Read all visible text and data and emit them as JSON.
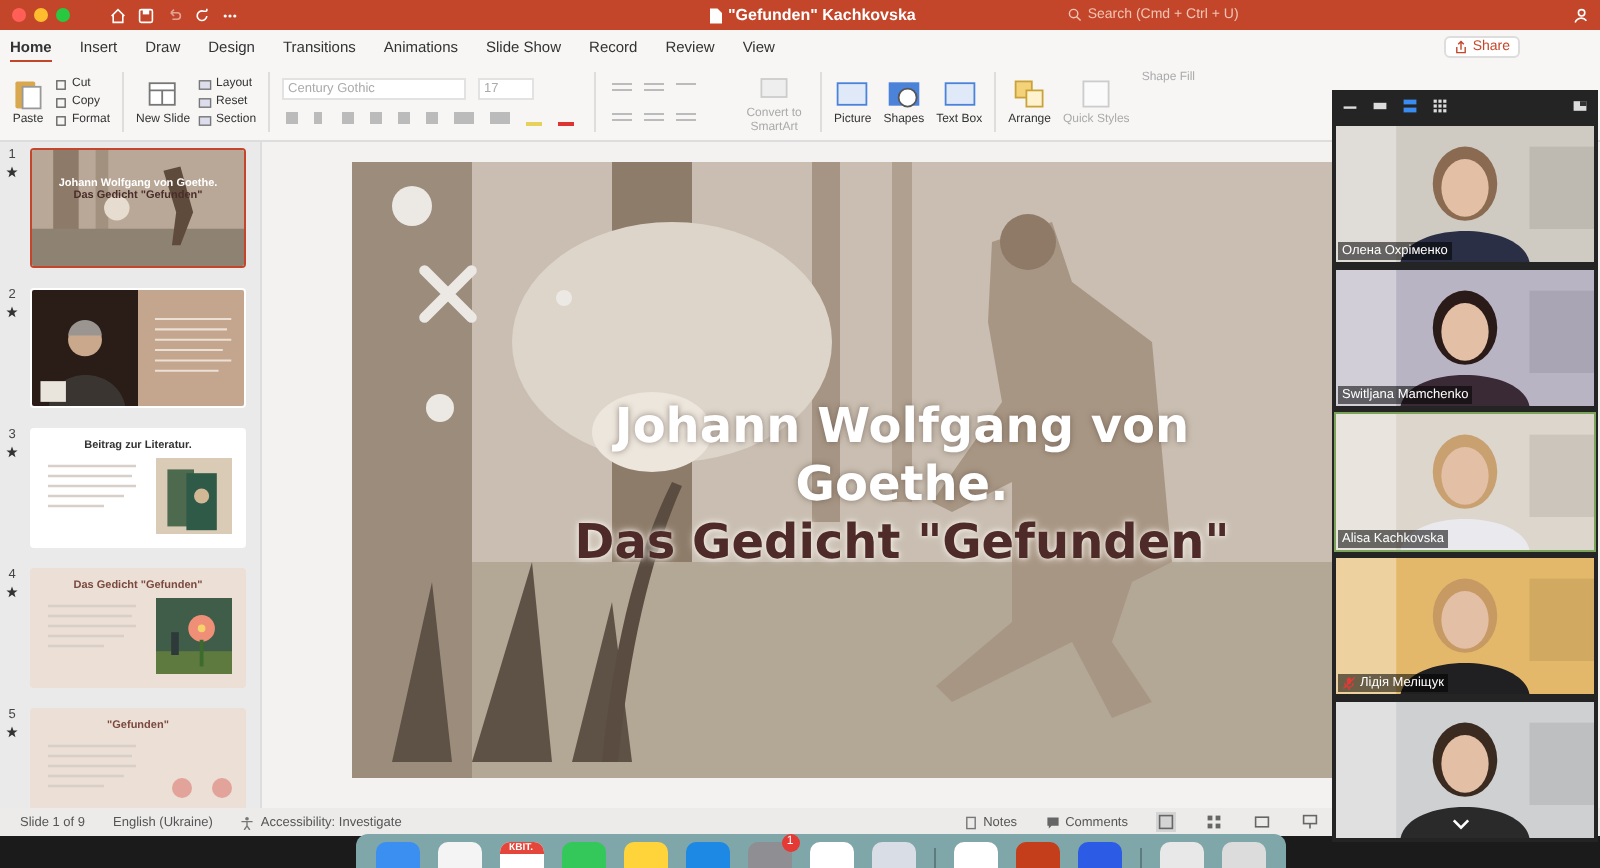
{
  "window": {
    "title": "\"Gefunden\" Kachkovska",
    "search_placeholder": "Search (Cmd + Ctrl + U)"
  },
  "tabs": [
    {
      "label": "Home",
      "selected": true
    },
    {
      "label": "Insert",
      "selected": false
    },
    {
      "label": "Draw",
      "selected": false
    },
    {
      "label": "Design",
      "selected": false
    },
    {
      "label": "Transitions",
      "selected": false
    },
    {
      "label": "Animations",
      "selected": false
    },
    {
      "label": "Slide Show",
      "selected": false
    },
    {
      "label": "Record",
      "selected": false
    },
    {
      "label": "Review",
      "selected": false
    },
    {
      "label": "View",
      "selected": false
    }
  ],
  "share": "Share",
  "ribbon": {
    "paste": "Paste",
    "clipboard": [
      "Cut",
      "Copy",
      "Format"
    ],
    "new_slide": "New Slide",
    "slides": [
      "Layout",
      "Reset",
      "Section"
    ],
    "font_family": "Century Gothic",
    "font_size": "17",
    "smartart": "Convert to SmartArt",
    "insert": [
      "Picture",
      "Shapes",
      "Text Box"
    ],
    "arrange": "Arrange",
    "quick_styles": "Quick Styles",
    "shape_fill": "Shape Fill"
  },
  "thumbnails": [
    {
      "number": "1",
      "selected": true,
      "kind": "title",
      "title": "Johann Wolfgang von Goethe.",
      "subtitle": "Das Gedicht \"Gefunden\""
    },
    {
      "number": "2",
      "selected": false,
      "kind": "portrait"
    },
    {
      "number": "3",
      "selected": false,
      "kind": "books",
      "title": "Beitrag zur Literatur."
    },
    {
      "number": "4",
      "selected": false,
      "kind": "flower",
      "title": "Das Gedicht \"Gefunden\""
    },
    {
      "number": "5",
      "selected": false,
      "kind": "poem",
      "title": "\"Gefunden\""
    }
  ],
  "slide": {
    "title": "Johann Wolfgang von Goethe.",
    "subtitle": "Das Gedicht \"Gefunden\""
  },
  "status_bar": {
    "slide": "Slide 1 of 9",
    "language": "English (Ukraine)",
    "accessibility": "Accessibility: Investigate",
    "notes": "Notes",
    "comments": "Comments"
  },
  "participants": [
    {
      "name": "Олена Охріменко",
      "speaking": false,
      "muted": false
    },
    {
      "name": "Switljana Mamchenko",
      "speaking": false,
      "muted": false
    },
    {
      "name": "Alisa Kachkovska",
      "speaking": true,
      "muted": false
    },
    {
      "name": "Лідія Меліщук",
      "speaking": false,
      "muted": true
    },
    {
      "speaking": false
    }
  ],
  "dock": [
    {
      "kind": "finder"
    },
    {
      "kind": "photos"
    },
    {
      "kind": "calendar",
      "label": "КВІТ."
    },
    {
      "kind": "facetime"
    },
    {
      "kind": "notes"
    },
    {
      "kind": "x"
    },
    {
      "kind": "settings",
      "badge": "1"
    },
    {
      "kind": "chrome"
    },
    {
      "kind": "launchpad"
    },
    {
      "kind": "divider"
    },
    {
      "kind": "telegram"
    },
    {
      "kind": "powerpoint"
    },
    {
      "kind": "app"
    },
    {
      "kind": "divider"
    },
    {
      "kind": "documents"
    },
    {
      "kind": "trash"
    }
  ]
}
